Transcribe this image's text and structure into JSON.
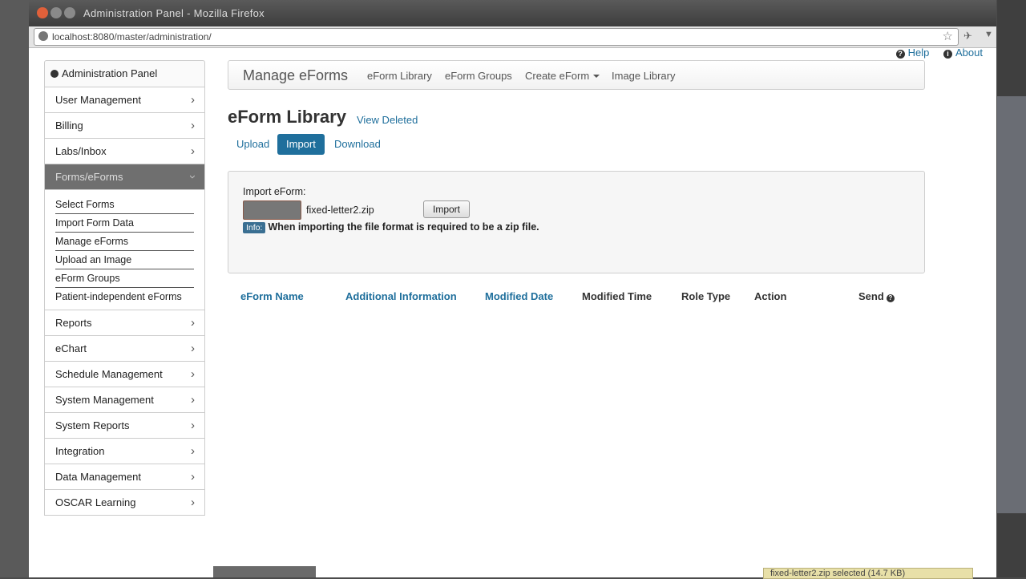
{
  "browser": {
    "window_title": "Administration Panel - Mozilla Firefox",
    "url": "localhost:8080/master/administration/",
    "bookmark_icon": "star-icon"
  },
  "top_links": {
    "help": "Help",
    "about": "About"
  },
  "sidebar": {
    "header": "Administration Panel",
    "items_top": [
      {
        "label": "User Management"
      },
      {
        "label": "Billing"
      },
      {
        "label": "Labs/Inbox"
      },
      {
        "label": "Forms/eForms"
      }
    ],
    "sub_items": [
      {
        "label": "Select Forms"
      },
      {
        "label": "Import Form Data"
      },
      {
        "label": "Manage eForms"
      },
      {
        "label": "Upload an Image"
      },
      {
        "label": "eForm Groups"
      },
      {
        "label": "Patient-independent eForms"
      }
    ],
    "items_bottom": [
      {
        "label": "Reports"
      },
      {
        "label": "eChart"
      },
      {
        "label": "Schedule Management"
      },
      {
        "label": "System Management"
      },
      {
        "label": "System Reports"
      },
      {
        "label": "Integration"
      },
      {
        "label": "Data Management"
      },
      {
        "label": "OSCAR Learning"
      }
    ]
  },
  "manage_nav": {
    "brand": "Manage eForms",
    "links": [
      "eForm Library",
      "eForm Groups",
      "Create eForm",
      "Image Library"
    ]
  },
  "main": {
    "title": "eForm Library",
    "view_deleted": "View Deleted",
    "tabs": [
      "Upload",
      "Import",
      "Download"
    ],
    "active_tab": "Import"
  },
  "import_box": {
    "label": "Import eForm:",
    "chosen_file": "fixed-letter2.zip",
    "import_button": "Import",
    "info_badge": "Info:",
    "info_text": "When importing the file format is required to be a zip file."
  },
  "table": {
    "columns": [
      "eForm Name",
      "Additional Information",
      "Modified Date",
      "Modified Time",
      "Role Type",
      "Action",
      "Send"
    ]
  },
  "status_bar": {
    "text": "fixed-letter2.zip selected (14.7 KB)"
  },
  "colors": {
    "link": "#1f6f9c",
    "active_tab_bg": "#1f6f9c",
    "sidebar_active_bg": "#6f6f6f"
  }
}
